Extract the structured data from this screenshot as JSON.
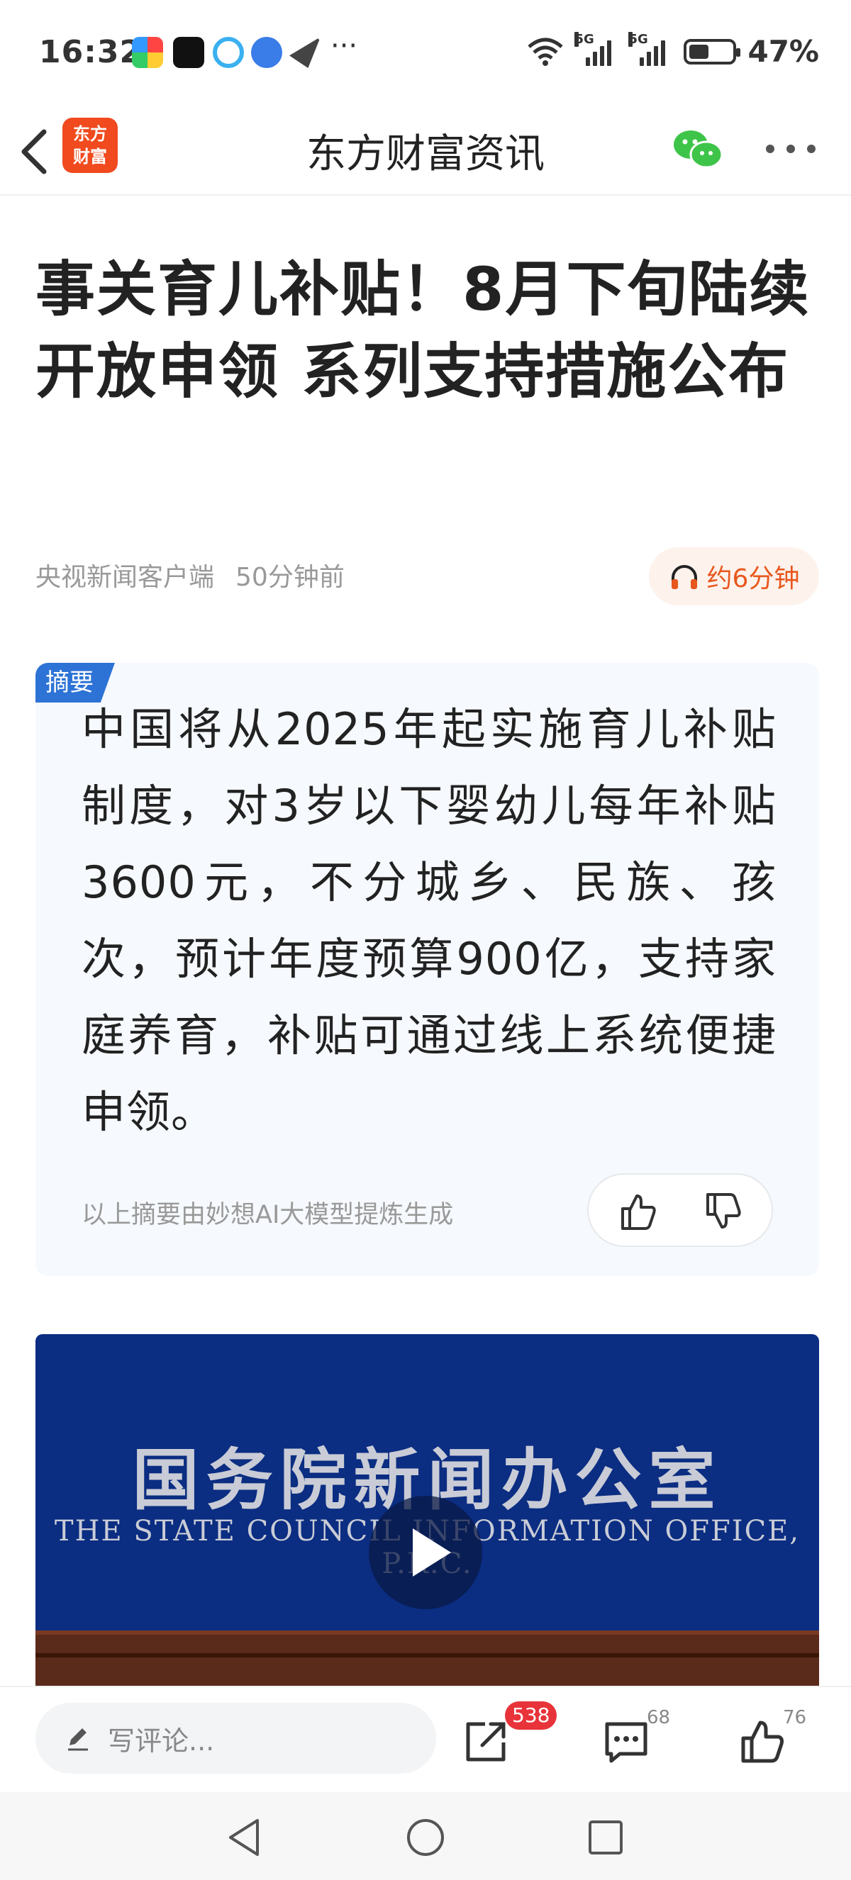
{
  "status_bar": {
    "time": "16:32",
    "network_1": "5G",
    "network_2": "5G",
    "battery_percent": "47%",
    "battery_level": 0.47,
    "more_notifications": "···"
  },
  "nav": {
    "logo_line1": "东方",
    "logo_line2": "财富",
    "title": "东方财富资讯",
    "colors": {
      "logo": "#f04a1e",
      "wechat": "#3fc44a"
    }
  },
  "article": {
    "headline": "事关育儿补贴！8月下旬陆续开放申领 系列支持措施公布",
    "source": "央视新闻客户端",
    "time_ago": "50分钟前",
    "audio_duration": "约6分钟"
  },
  "summary": {
    "tag": "摘要",
    "text": "中国将从2025年起实施育儿补贴制度，对3岁以下婴幼儿每年补贴3600元，不分城乡、民族、孩次，预计年度预算900亿，支持家庭养育，补贴可通过线上系统便捷申领。",
    "footnote": "以上摘要由妙想AI大模型提炼生成"
  },
  "video": {
    "title_cn": "国务院新闻办公室",
    "title_en": "THE STATE COUNCIL INFORMATION OFFICE, P.R.C."
  },
  "bottom_bar": {
    "comment_placeholder": "写评论...",
    "share_count": "538",
    "comment_count": "68",
    "like_count": "76"
  },
  "icons": [
    "back-icon",
    "wechat-icon",
    "more-icon",
    "headphones-icon",
    "thumbs-up-icon",
    "thumbs-down-icon",
    "play-icon",
    "pencil-icon",
    "share-icon",
    "comment-icon",
    "like-icon",
    "nav-back-icon",
    "nav-home-icon",
    "nav-recent-icon"
  ]
}
